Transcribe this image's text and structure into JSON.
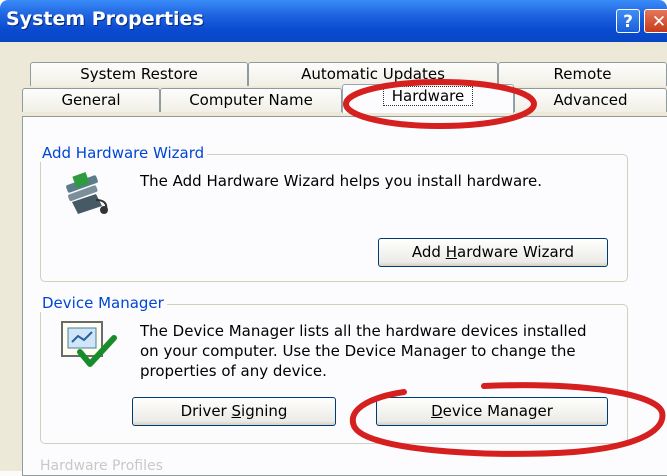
{
  "window": {
    "title": "System Properties",
    "help_label": "?",
    "close_label": "✕"
  },
  "tabs": {
    "row1": [
      "System Restore",
      "Automatic Updates",
      "Remote"
    ],
    "row2": [
      "General",
      "Computer Name",
      "Hardware",
      "Advanced"
    ],
    "active": "Hardware"
  },
  "add_hardware": {
    "legend": "Add Hardware Wizard",
    "description": "The Add Hardware Wizard helps you install hardware.",
    "button_pre": "Add ",
    "button_accel": "H",
    "button_post": "ardware Wizard",
    "icon": "hardware-wizard-icon"
  },
  "device_manager": {
    "legend": "Device Manager",
    "description_1": "The Device Manager lists all the hardware devices installed",
    "description_2": "on your computer. Use the Device Manager to change the",
    "description_3": "properties of any device.",
    "driver_pre": "Driver ",
    "driver_accel": "S",
    "driver_post": "igning",
    "dm_accel": "D",
    "dm_post": "evice Manager",
    "icon": "device-manager-icon"
  },
  "hardware_profiles": {
    "legend": "Hardware Profiles"
  },
  "annotation": {
    "color": "#d61f1f"
  }
}
